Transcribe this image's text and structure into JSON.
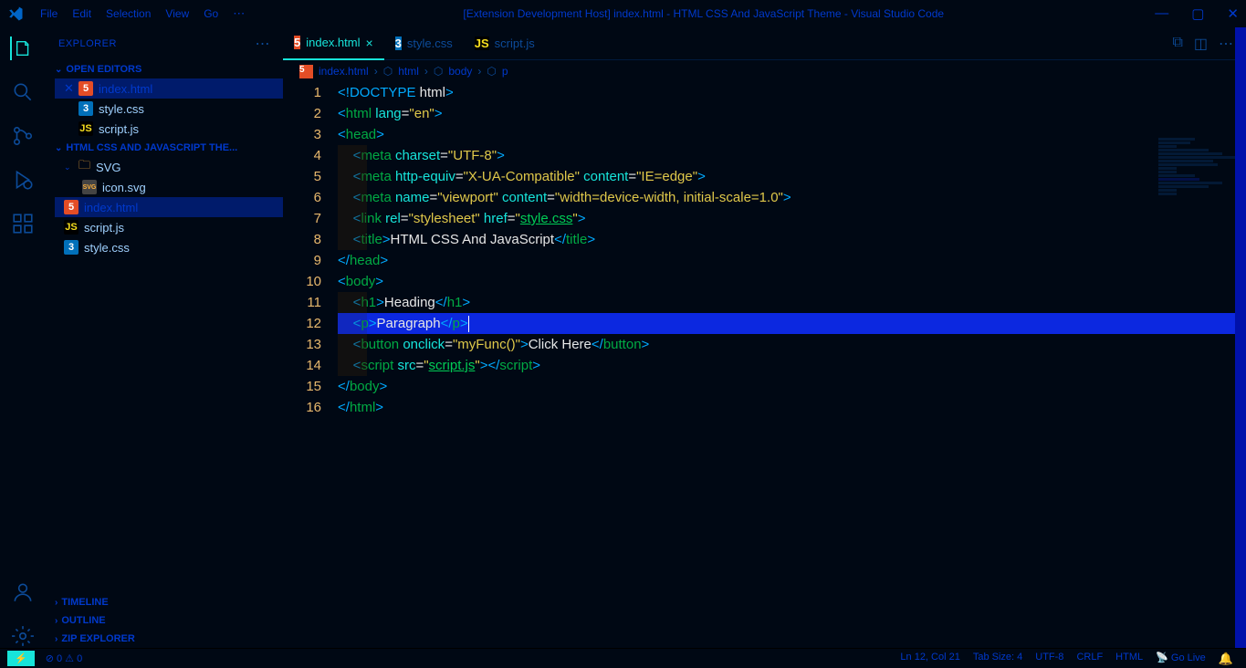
{
  "window": {
    "title": "[Extension Development Host] index.html - HTML CSS And JavaScript Theme - Visual Studio Code",
    "menu": [
      "File",
      "Edit",
      "Selection",
      "View",
      "Go"
    ]
  },
  "sidebar": {
    "title": "EXPLORER",
    "open_editors": "OPEN EDITORS",
    "project": "HTML CSS AND JAVASCRIPT THE...",
    "folder_svg": "SVG",
    "files": {
      "index": "index.html",
      "style": "style.css",
      "script": "script.js",
      "icon": "icon.svg"
    },
    "bottom": {
      "timeline": "TIMELINE",
      "outline": "OUTLINE",
      "zip": "ZIP EXPLORER"
    }
  },
  "tabs": [
    {
      "icon": "html",
      "label": "index.html",
      "active": true,
      "close": true
    },
    {
      "icon": "css",
      "label": "style.css",
      "active": false,
      "close": false
    },
    {
      "icon": "js",
      "label": "script.js",
      "active": false,
      "close": false
    }
  ],
  "breadcrumb": [
    "index.html",
    "html",
    "body",
    "p"
  ],
  "code_lines": 16,
  "statusbar": {
    "errors": "0",
    "warnings": "0",
    "ln_col": "Ln 12, Col 21",
    "spaces": "Tab Size: 4",
    "encoding": "UTF-8",
    "eol": "CRLF",
    "lang": "HTML",
    "golive": "Go Live"
  },
  "code": {
    "l1_doctype": "DOCTYPE",
    "l1_html": " html",
    "l2_html": "html",
    "l2_attr": " lang",
    "l2_eq": "=",
    "l2_val": "\"en\"",
    "l3_head": "head",
    "l4_meta": "meta",
    "l4_attr": " charset",
    "l4_val": "\"UTF-8\"",
    "l5_meta": "meta",
    "l5_attr1": " http-equiv",
    "l5_val1": "\"X-UA-Compatible\"",
    "l5_attr2": " content",
    "l5_val2": "\"IE=edge\"",
    "l6_meta": "meta",
    "l6_attr1": " name",
    "l6_val1": "\"viewport\"",
    "l6_attr2": " content",
    "l6_val2": "\"width=device-width, initial-scale=1.0\"",
    "l7_link": "link",
    "l7_attr1": " rel",
    "l7_val1": "\"stylesheet\"",
    "l7_attr2": " href",
    "l7_val2a": "\"",
    "l7_val2b": "style.css",
    "l7_val2c": "\"",
    "l8_title": "title",
    "l8_text": "HTML CSS And JavaScript",
    "l9_head": "head",
    "l10_body": "body",
    "l11_h1": "h1",
    "l11_text": "Heading",
    "l12_p": "p",
    "l12_text": "Paragraph",
    "l13_button": "button",
    "l13_attr": " onclick",
    "l13_val": "\"myFunc()\"",
    "l13_text": "Click Here",
    "l14_script": "script",
    "l14_attr": " src",
    "l14_val_a": "\"",
    "l14_val_b": "script.js",
    "l14_val_c": "\"",
    "l15_body": "body",
    "l16_html": "html"
  }
}
